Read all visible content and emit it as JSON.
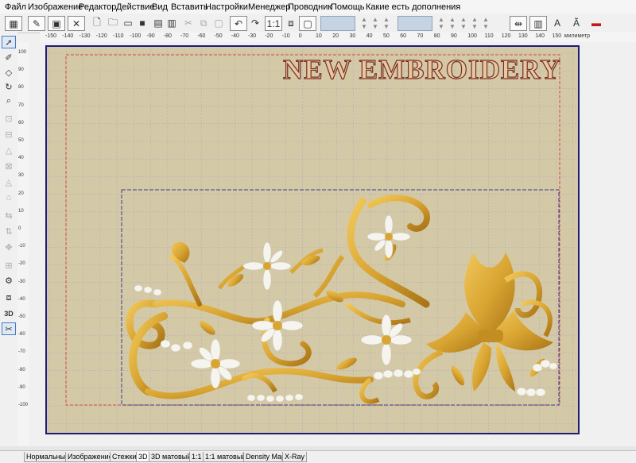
{
  "menu": [
    "Файл",
    "Изображение",
    "Редактор",
    "Действие",
    "Вид",
    "Вставить",
    "Настройки",
    "Менеджер",
    "Проводник",
    "Помощь",
    "Какие есть дополнения"
  ],
  "ruler": {
    "unit": "милиметр",
    "h_ticks": [
      "-150",
      "-140",
      "-130",
      "-120",
      "-110",
      "-100",
      "-90",
      "-80",
      "-70",
      "-60",
      "-50",
      "-40",
      "-30",
      "-20",
      "-10",
      "0",
      "10",
      "20",
      "30",
      "40",
      "50",
      "60",
      "70",
      "80",
      "90",
      "100",
      "110",
      "120",
      "130",
      "140",
      "150"
    ],
    "v_ticks": [
      "100",
      "90",
      "80",
      "70",
      "60",
      "50",
      "40",
      "30",
      "20",
      "10",
      "0",
      "-10",
      "-20",
      "-30",
      "-40",
      "-50",
      "-60",
      "-70",
      "-80",
      "-90",
      "-100"
    ]
  },
  "toolbar_icons": [
    "open-icon",
    "add-image-icon",
    "image-settings-icon",
    "remove-background-icon",
    "new-icon",
    "open-file-icon",
    "save-icon",
    "save-as-icon",
    "cut-icon",
    "copy-icon",
    "paste-icon",
    "undo-icon",
    "redo-icon",
    "actual-size-icon",
    "zoom-fit-icon",
    "hoop-icon",
    "color-field",
    "color-field-2",
    "mirror-icon",
    "align-icon",
    "text-a-icon",
    "text-b-icon",
    "stop-icon"
  ],
  "left_tools": [
    "select-icon",
    "edit-icon",
    "shape-icon",
    "rotate-icon",
    "zoom-icon",
    "tool-6",
    "tool-7",
    "tool-8",
    "tool-9",
    "tool-10",
    "tool-11",
    "tool-12",
    "tool-13",
    "tool-14",
    "tool-15",
    "tool-16",
    "3d-icon",
    "stitch-icon"
  ],
  "left_tool_3d_label": "3D",
  "canvas": {
    "watermark": "NEW EMBROIDERY",
    "background_color": "#d4c9a6",
    "grid_color": "#b5aab9",
    "hoop_color": "#1c1c7a",
    "outer_frame_color": "#d24a4a",
    "design_frame_color": "#3a3a90",
    "gold": "#d9a532",
    "gold_dark": "#9b6c12",
    "white": "#f6f4ee"
  },
  "view_tabs": [
    "Нормальный",
    "Изображение",
    "Стежки",
    "3D",
    "3D матовый",
    "1:1",
    "1:1 матовый",
    "Density Map",
    "X-Ray"
  ],
  "active_tab": "3D"
}
